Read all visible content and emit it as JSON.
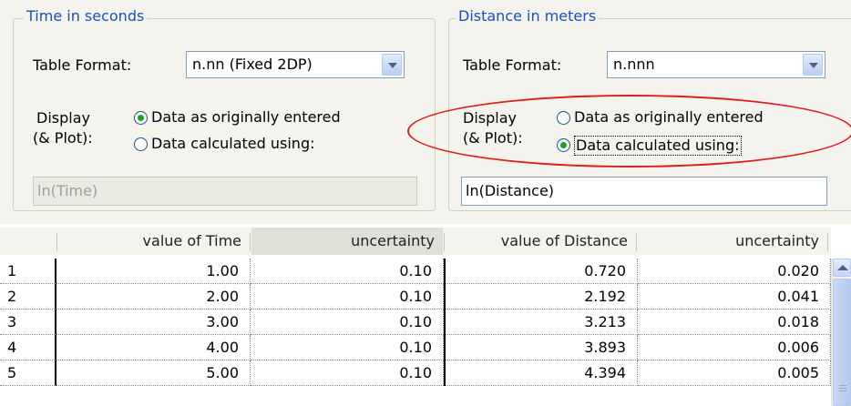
{
  "time_panel": {
    "legend": "Time in seconds",
    "table_format_label": "Table Format:",
    "table_format_value": "n.nn (Fixed 2DP)",
    "display_label_line1": "Display",
    "display_label_line2": "(& Plot):",
    "radio_original_label": "Data as originally entered",
    "radio_calculated_label": "Data calculated using:",
    "selected": "original",
    "formula": "ln(Time)",
    "formula_enabled": false
  },
  "distance_panel": {
    "legend": "Distance in meters",
    "table_format_label": "Table Format:",
    "table_format_value": "n.nnn",
    "display_label_line1": "Display",
    "display_label_line2": "(& Plot):",
    "radio_original_label": "Data as originally entered",
    "radio_calculated_label": "Data calculated using:",
    "selected": "calculated",
    "formula": "ln(Distance)",
    "formula_enabled": true
  },
  "table": {
    "columns": [
      "value of Time",
      "uncertainty",
      "value of Distance",
      "uncertainty"
    ],
    "selected_column": 1,
    "rows": [
      {
        "num": "1",
        "time": "1.00",
        "time_unc": "0.10",
        "dist": "0.720",
        "dist_unc": "0.020"
      },
      {
        "num": "2",
        "time": "2.00",
        "time_unc": "0.10",
        "dist": "2.192",
        "dist_unc": "0.041"
      },
      {
        "num": "3",
        "time": "3.00",
        "time_unc": "0.10",
        "dist": "3.213",
        "dist_unc": "0.018"
      },
      {
        "num": "4",
        "time": "4.00",
        "time_unc": "0.10",
        "dist": "3.893",
        "dist_unc": "0.006"
      },
      {
        "num": "5",
        "time": "5.00",
        "time_unc": "0.10",
        "dist": "4.394",
        "dist_unc": "0.005"
      }
    ]
  },
  "colors": {
    "legend_text": "#1a4fb5",
    "annotation_ellipse": "#e01b1b",
    "radio_selected": "#21a121"
  }
}
